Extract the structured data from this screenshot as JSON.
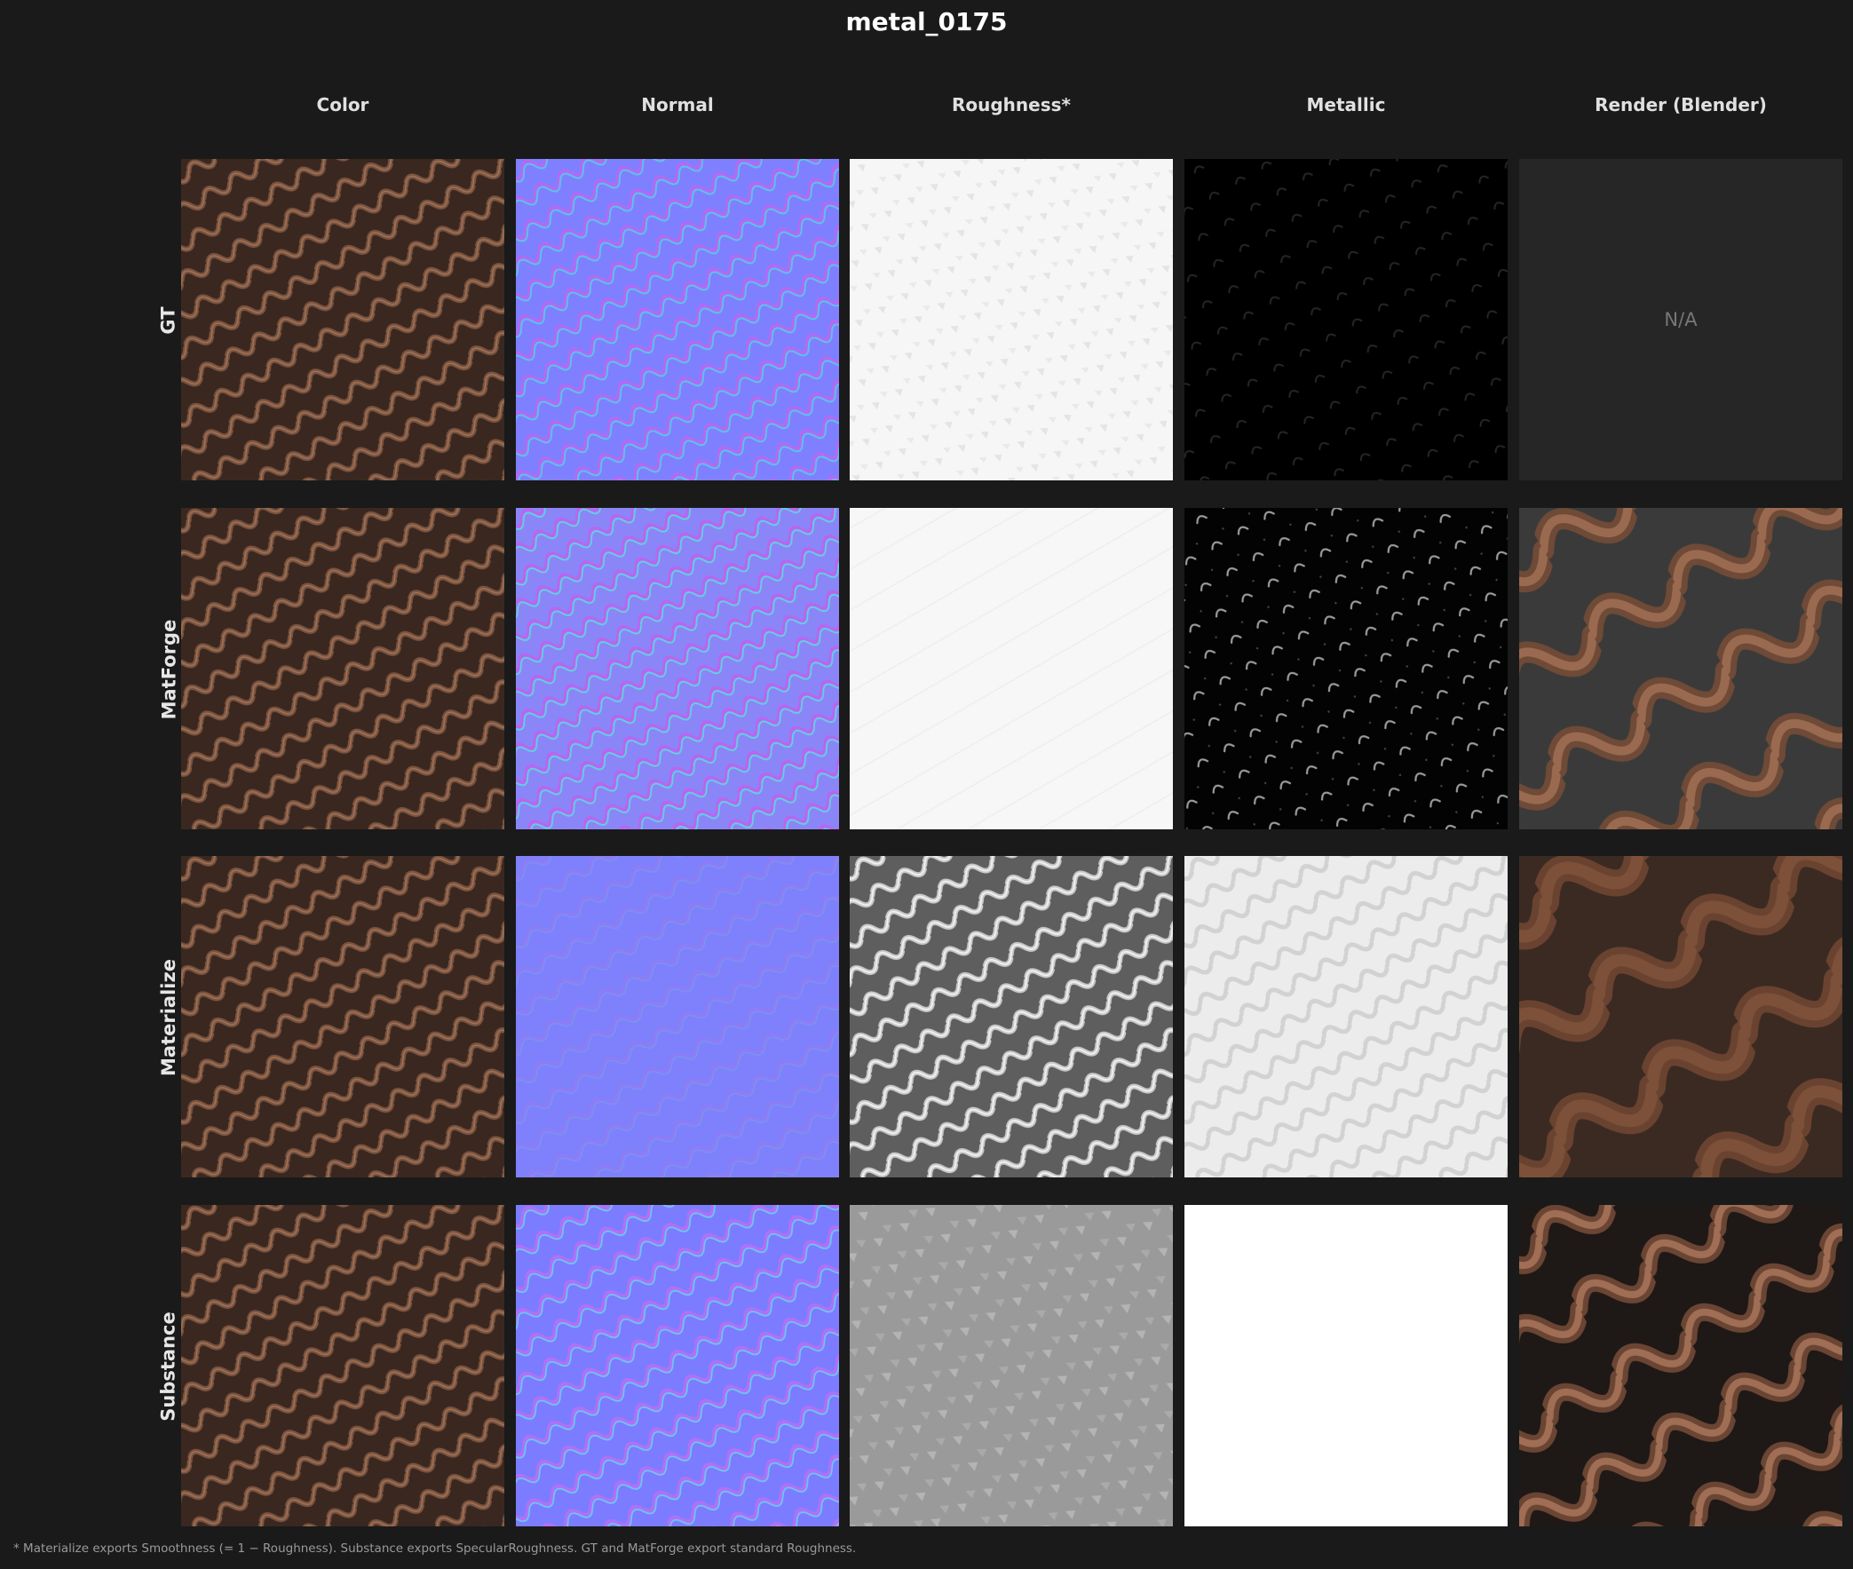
{
  "title": "metal_0175",
  "columns": [
    "Color",
    "Normal",
    "Roughness*",
    "Metallic",
    "Render (Blender)"
  ],
  "rows": [
    {
      "label": "GT",
      "render": "N/A"
    },
    {
      "label": "MatForge",
      "render": ""
    },
    {
      "label": "Materialize",
      "render": ""
    },
    {
      "label": "Substance",
      "render": ""
    }
  ],
  "footnote": "* Materialize exports Smoothness (= 1 − Roughness). Substance exports SpecularRoughness. GT and MatForge export standard Roughness.",
  "colors": {
    "background": "#1a1a1a",
    "color_map_base": "#3a2820",
    "color_map_links": "#7a5440",
    "normal_base": "#7e80ff",
    "normal_highlight": "#b26af5"
  }
}
